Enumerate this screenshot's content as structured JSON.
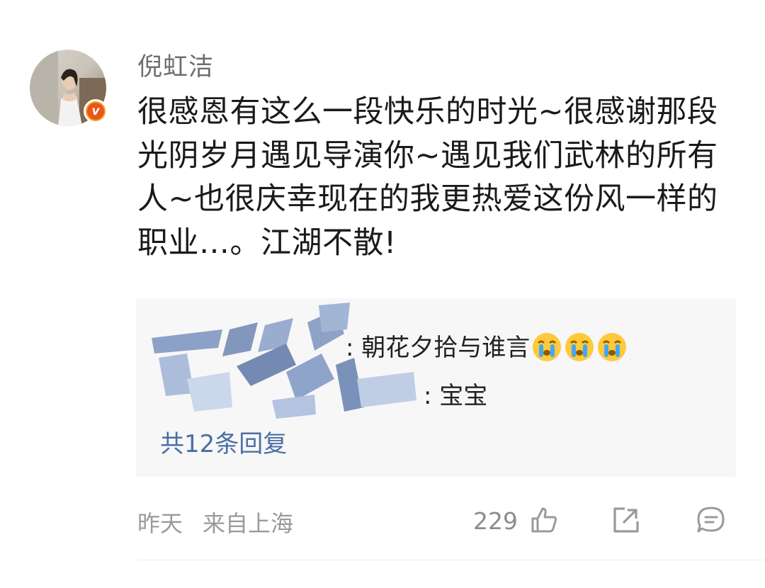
{
  "user": {
    "name": "倪虹洁",
    "verified_badge": "v"
  },
  "comment": {
    "text": "很感恩有这么一段快乐的时光~很感谢那段光阴岁月遇见导演你~遇见我们武林的所有人~也很庆幸现在的我更热爱这份风一样的职业…。江湖不散!"
  },
  "replies": {
    "items": [
      {
        "text": ": 朝花夕拾与谁言",
        "emoji": "crying-face",
        "emoji_count": 3
      },
      {
        "text": ": 宝宝"
      }
    ],
    "more_label": "共12条回复"
  },
  "footer": {
    "time": "昨天",
    "location": "来自上海",
    "like_count": "229"
  },
  "colors": {
    "link": "#4a6fa5",
    "meta": "#9a9a9a",
    "reply_bg": "#f7f7f7",
    "badge": "#f7a21b"
  }
}
